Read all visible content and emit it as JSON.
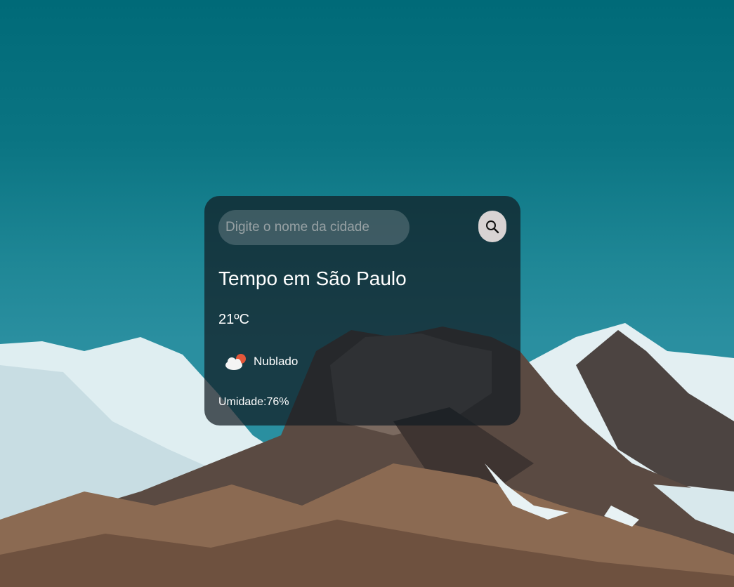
{
  "search": {
    "placeholder": "Digite o nome da cidade",
    "button_icon": "search-icon"
  },
  "weather": {
    "title": "Tempo em São Paulo",
    "temperature": "21ºC",
    "condition_icon": "partly-cloudy-icon",
    "condition": "Nublado",
    "humidity": "Umidade:76%"
  },
  "colors": {
    "sky": "#006a78",
    "card": "#121c22",
    "button": "#d8d3d3",
    "text": "#ffffff"
  }
}
